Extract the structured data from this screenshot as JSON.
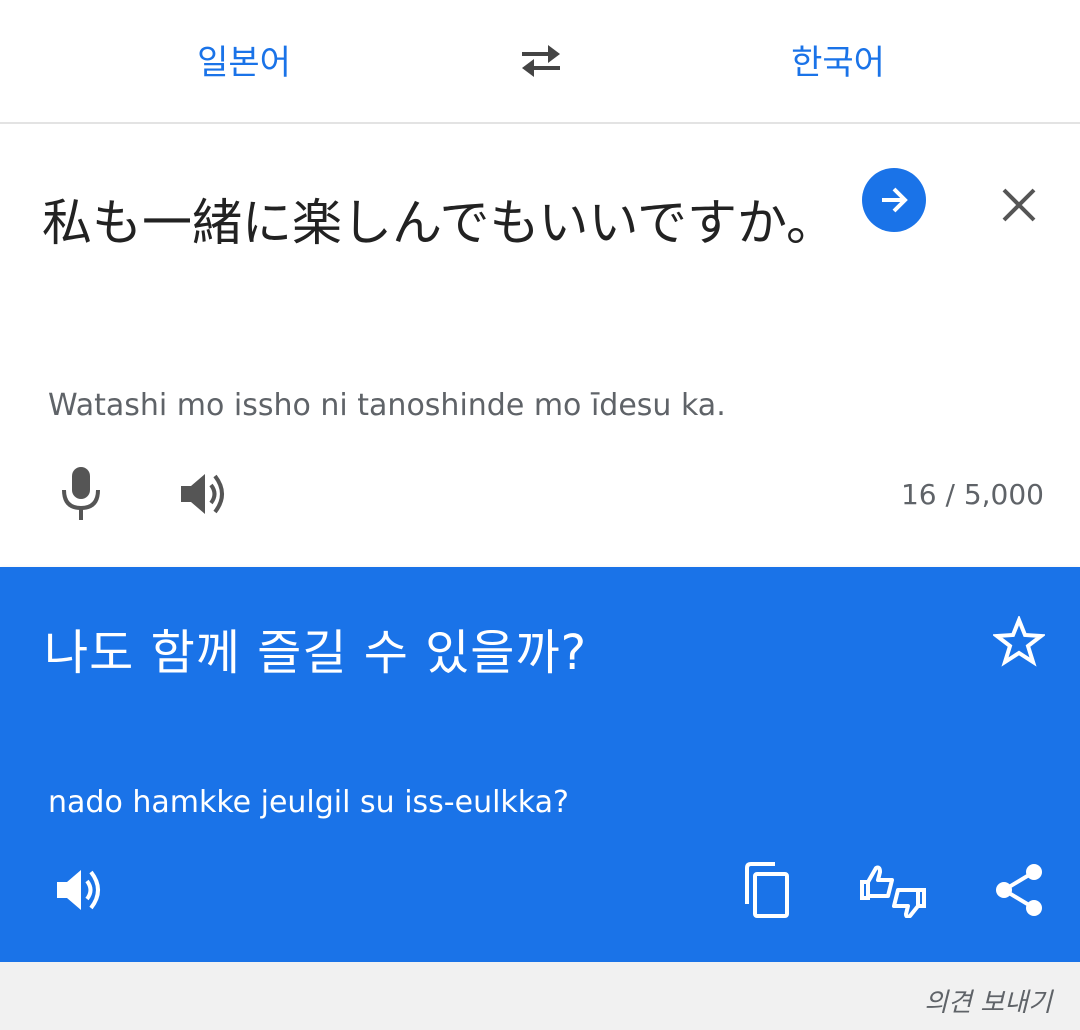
{
  "language_bar": {
    "source_language": "일본어",
    "target_language": "한국어",
    "swap_icon": "swap-horiz-icon"
  },
  "input": {
    "source_text": "私も一緒に楽しんでもいいですか。",
    "romanization": "Watashi mo issho ni tanoshinde mo īdesu ka.",
    "char_count": "16 / 5,000",
    "icons": [
      "arrow-forward-icon",
      "close-icon",
      "mic-icon",
      "volume-icon"
    ]
  },
  "result": {
    "translated_text": "나도 함께 즐길 수 있을까?",
    "romanization": "nado hamkke jeulgil su iss-eulkka?",
    "icons": [
      "star-icon",
      "volume-icon",
      "copy-icon",
      "feedback-icon",
      "share-icon"
    ]
  },
  "footer": {
    "send_feedback": "의견 보내기"
  },
  "colors": {
    "accent": "#1a73e8",
    "text_primary": "#222222",
    "text_secondary": "#5f6368",
    "footer_bg": "#f1f1f1"
  }
}
